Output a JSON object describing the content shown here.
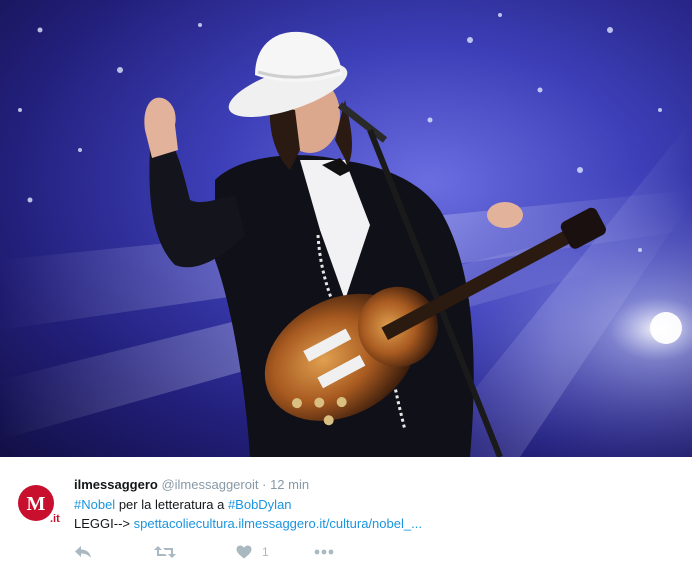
{
  "tweet": {
    "author_name": "ilmessaggero",
    "handle": "@ilmessaggeroit",
    "separator": "·",
    "timestamp": "12 min",
    "avatar_text": "M",
    "avatar_suffix": ".it",
    "text_hashtag1": "#Nobel",
    "text_middle": " per la letteratura a ",
    "text_hashtag2": "#BobDylan",
    "text_prefix": "LEGGI--> ",
    "text_link": "spettacoliecultura.ilmessaggero.it/cultura/nobel_...",
    "like_count": "1",
    "colors": {
      "link": "#1b95e0",
      "text": "#14171a",
      "muted": "#8899a6",
      "icon": "#aab8c2",
      "avatar": "#c8102e"
    }
  },
  "icons": [
    "reply-icon",
    "retweet-icon",
    "like-icon",
    "more-icon"
  ]
}
